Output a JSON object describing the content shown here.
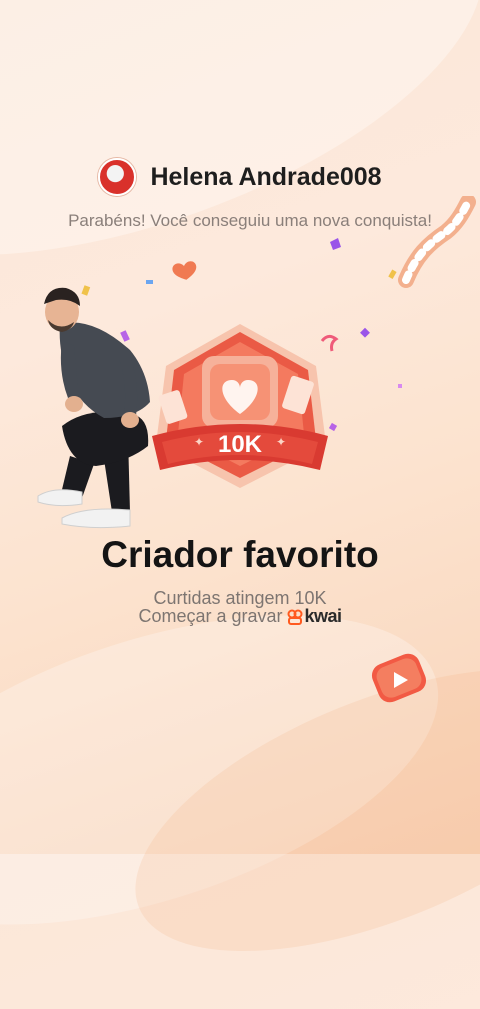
{
  "user": {
    "name": "Helena Andrade008"
  },
  "message": {
    "congrats": "Parabéns! Você conseguiu uma nova conquista!"
  },
  "badge": {
    "value_label": "10K"
  },
  "achievement": {
    "title": "Criador favorito",
    "subtitle": "Curtidas atingem 10K",
    "cta": "Começar a gravar",
    "brand": "kwai"
  },
  "colors": {
    "badge_red": "#e6473a",
    "badge_light": "#f7a488",
    "text_dark": "#141414",
    "text_gray": "#7d7571",
    "kwai_orange": "#ff5a1f"
  },
  "icons": {
    "badge": "heart-badge-icon",
    "logo": "kwai-logo-icon",
    "play": "play-icon"
  }
}
